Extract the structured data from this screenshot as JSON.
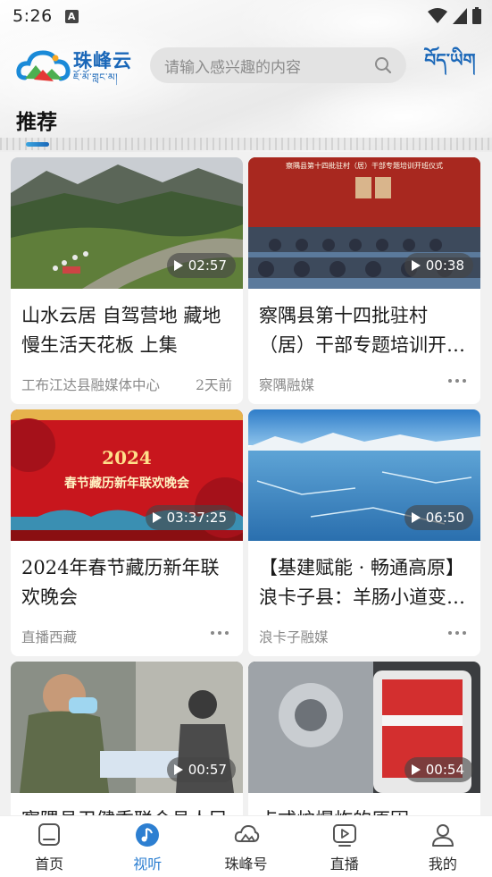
{
  "status_bar": {
    "time": "5:26",
    "notification_letter": "A"
  },
  "header": {
    "logo_cn": "珠峰云",
    "logo_tibetan": "ཇོ་མོ་གླང་མ།",
    "search_placeholder": "请输入感兴趣的内容",
    "language_toggle": "བོད་ཡིག",
    "section_title": "推荐"
  },
  "colors": {
    "brand_blue": "#1a67b8",
    "active_tab": "#2d7fd1"
  },
  "videos": [
    {
      "title": "山水云居 自驾营地 藏地慢生活天花板 上集",
      "source": "工布江达县融媒体中心",
      "time": "2天前",
      "duration": "02:57",
      "thumb": "mountain-river-landscape"
    },
    {
      "title": "察隅县第十四批驻村（居）干部专题培训开班仪式",
      "source": "察隅融媒",
      "time": "",
      "duration": "00:38",
      "thumb": "conference-hall-meeting"
    },
    {
      "title": "2024年春节藏历新年联欢晚会",
      "source": "直播西藏",
      "time": "",
      "duration": "03:37:25",
      "thumb": "red-festival-poster"
    },
    {
      "title": "【基建赋能 · 畅通高原】浪卡子县：羊肠小道变坦途",
      "source": "浪卡子融媒",
      "time": "",
      "duration": "06:50",
      "thumb": "frozen-lake-mountains"
    },
    {
      "title": "察隅县卫健委联合县人民医院开展义诊活动",
      "source": "",
      "time": "",
      "duration": "00:57",
      "thumb": "medical-volunteers"
    },
    {
      "title": "点式炉爆炸的原因",
      "source": "",
      "time": "",
      "duration": "00:54",
      "thumb": "engine-parts-closeup"
    }
  ],
  "poster_text": {
    "year": "2024",
    "event": "春节藏历新年联欢晚会"
  },
  "thumb2_banner": "察隅县第十四批驻村（居）干部专题培训开班仪式",
  "bottom_nav": [
    {
      "label": "首页",
      "icon": "home-icon",
      "active": false
    },
    {
      "label": "视听",
      "icon": "music-note-icon",
      "active": true
    },
    {
      "label": "珠峰号",
      "icon": "cloud-icon",
      "active": false
    },
    {
      "label": "直播",
      "icon": "live-play-icon",
      "active": false
    },
    {
      "label": "我的",
      "icon": "user-icon",
      "active": false
    }
  ]
}
